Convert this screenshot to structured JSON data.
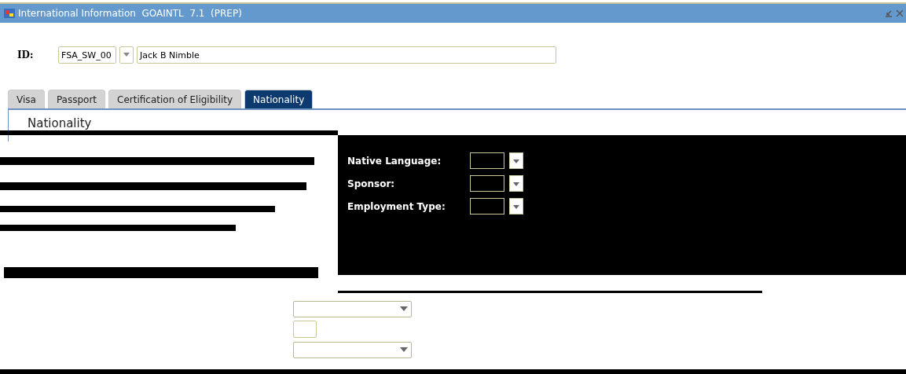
{
  "window": {
    "title": "International Information  GOAINTL  7.1  (PREP)"
  },
  "key_block": {
    "label": "ID:",
    "id_value": "FSA_SW_00",
    "name_value": "Jack B Nimble"
  },
  "tabs": [
    {
      "label": "Visa",
      "selected": false
    },
    {
      "label": "Passport",
      "selected": false
    },
    {
      "label": "Certification of Eligibility",
      "selected": false
    },
    {
      "label": "Nationality",
      "selected": true
    }
  ],
  "section_title": "Nationality",
  "fields": [
    {
      "label": "Native Language:",
      "kind": "lookup"
    },
    {
      "label": "Sponsor:",
      "kind": "lookup"
    },
    {
      "label": "Employment Type:",
      "kind": "lookup"
    }
  ],
  "lower_fields": [
    {
      "kind": "dropdown"
    },
    {
      "kind": "text"
    },
    {
      "kind": "dropdown"
    }
  ]
}
